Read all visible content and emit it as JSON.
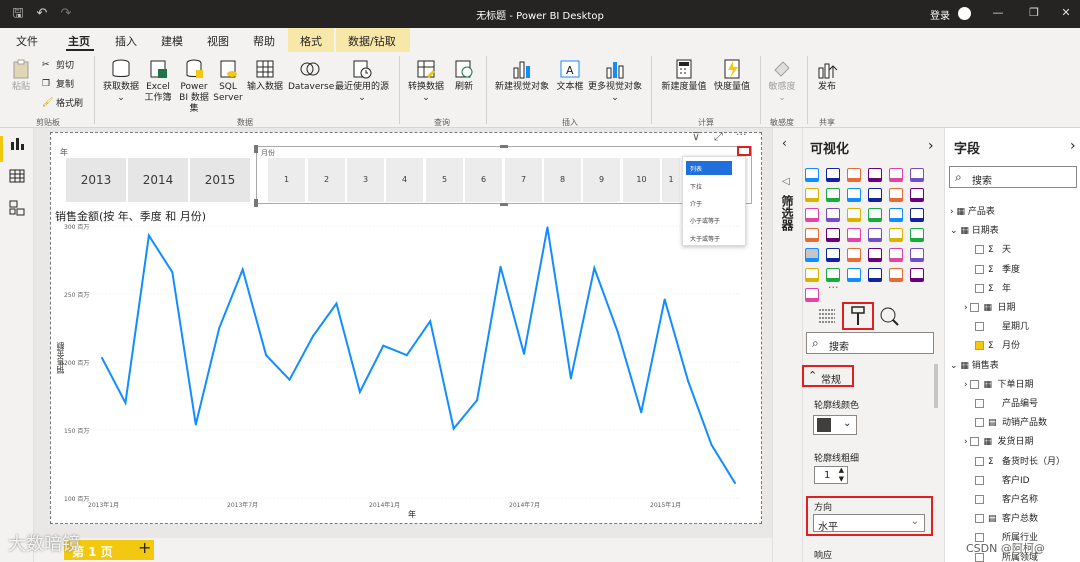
{
  "window": {
    "title": "无标题 - Power BI Desktop",
    "signin": "登录"
  },
  "menu": {
    "tabs": [
      "文件",
      "主页",
      "插入",
      "建模",
      "视图",
      "帮助",
      "格式",
      "数据/钻取"
    ]
  },
  "ribbon": {
    "clipboard": {
      "paste": "粘贴",
      "cut": "剪切",
      "copy": "复制",
      "format_painter": "格式刷",
      "group": "剪贴板"
    },
    "data": {
      "get_data": "获取数据",
      "excel": "Excel 工作簿",
      "pbi": "Power BI 数据集",
      "sql": "SQL Server",
      "enter": "输入数据",
      "dataverse": "Dataverse",
      "recent": "最近使用的源",
      "group": "数据"
    },
    "query": {
      "transform": "转换数据",
      "refresh": "刷新",
      "group": "查询"
    },
    "insert": {
      "new_visual": "新建视觉对象",
      "textbox": "文本框",
      "more": "更多视觉对象",
      "group": "插入"
    },
    "calc": {
      "new_measure": "新建度量值",
      "quick_measure": "快度量值",
      "group": "计算"
    },
    "sensitivity": {
      "label": "敏感度",
      "group": "敏感度"
    },
    "share": {
      "publish": "发布",
      "group": "共享"
    }
  },
  "slicer_year": {
    "title": "年",
    "items": [
      "2013",
      "2014",
      "2015"
    ]
  },
  "slicer_month": {
    "title": "月份",
    "items": [
      "1",
      "2",
      "3",
      "4",
      "5",
      "6",
      "7",
      "8",
      "9",
      "10",
      "1"
    ]
  },
  "dropdown": {
    "items": [
      "列表",
      "下拉",
      "介于",
      "小于或等于",
      "大于或等于"
    ]
  },
  "chart_data": {
    "type": "line",
    "title": "销售金额(按 年、季度 和 月份)",
    "xlabel": "年",
    "ylabel": "销售金额",
    "y_ticks": [
      "300 百万",
      "250 百万",
      "200 百万",
      "150 百万",
      "100 百万"
    ],
    "x_ticks": [
      "2013年1月",
      "2013年7月",
      "2014年1月",
      "2014年7月",
      "2015年1月"
    ],
    "ylim": [
      100,
      300
    ],
    "color": "#118dff",
    "values": [
      203,
      170,
      293,
      266,
      154,
      225,
      268,
      205,
      187,
      219,
      243,
      178,
      212,
      205,
      230,
      151,
      172,
      270,
      206,
      299,
      188,
      269,
      222,
      163,
      246,
      186,
      139,
      111
    ]
  },
  "filters": {
    "label": "筛选器"
  },
  "viz": {
    "title": "可视化",
    "search": "搜索",
    "section": "常规",
    "outline_color": "轮廓线颜色",
    "outline_weight": "轮廓线粗细",
    "weight_value": "1",
    "orientation": "方向",
    "orientation_value": "水平",
    "responsive": "响应",
    "more": "···"
  },
  "fields": {
    "title": "字段",
    "search": "搜索",
    "items": [
      {
        "label": "产品表",
        "indent": 0,
        "type": "table"
      },
      {
        "label": "日期表",
        "indent": 0,
        "type": "table"
      },
      {
        "label": "天",
        "indent": 1,
        "type": "sigma"
      },
      {
        "label": "季度",
        "indent": 1,
        "type": "sigma"
      },
      {
        "label": "年",
        "indent": 1,
        "type": "sigma"
      },
      {
        "label": "日期",
        "indent": 1,
        "type": "cal"
      },
      {
        "label": "星期几",
        "indent": 1,
        "type": "plain"
      },
      {
        "label": "月份",
        "indent": 1,
        "type": "sigma",
        "checked": true
      },
      {
        "label": "销售表",
        "indent": 0,
        "type": "table"
      },
      {
        "label": "下单日期",
        "indent": 1,
        "type": "cal"
      },
      {
        "label": "产品编号",
        "indent": 1,
        "type": "plain"
      },
      {
        "label": "动销产品数",
        "indent": 1,
        "type": "calc"
      },
      {
        "label": "发货日期",
        "indent": 1,
        "type": "cal"
      },
      {
        "label": "备货时长（月）",
        "indent": 1,
        "type": "sigma"
      },
      {
        "label": "客户ID",
        "indent": 1,
        "type": "plain"
      },
      {
        "label": "客户名称",
        "indent": 1,
        "type": "plain"
      },
      {
        "label": "客户总数",
        "indent": 1,
        "type": "calc"
      },
      {
        "label": "所属行业",
        "indent": 1,
        "type": "plain"
      },
      {
        "label": "所属领域",
        "indent": 1,
        "type": "plain"
      }
    ]
  },
  "pages": {
    "tab": "第 1 页",
    "add": "+"
  },
  "watermarks": {
    "left": "大数暗镜",
    "right": "CSDN @阿柯@"
  }
}
